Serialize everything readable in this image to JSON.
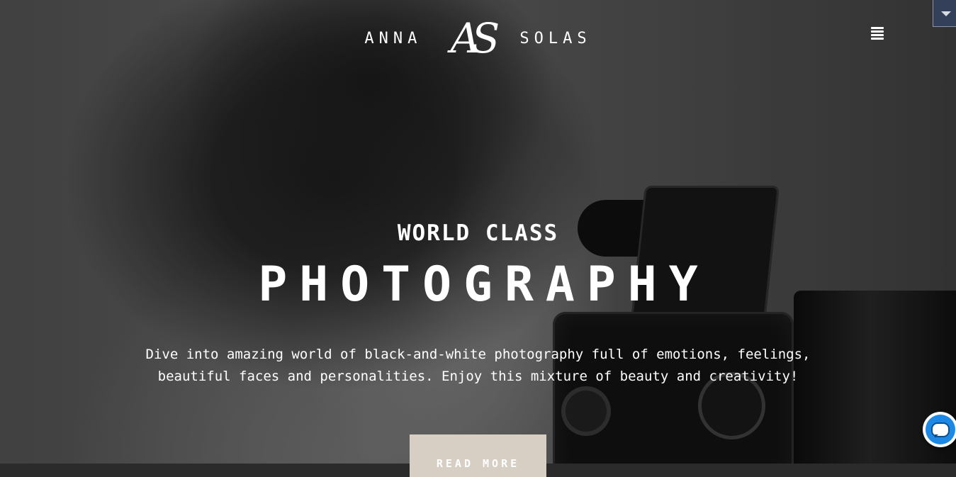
{
  "header": {
    "logo_first": "ANNA",
    "logo_monogram": "AS",
    "logo_last": "SOLAS"
  },
  "hero": {
    "tagline": "WORLD CLASS",
    "headline": "PHOTOGRAPHY",
    "description": "Dive into amazing world of black-and-white photography full of emotions, feelings, beautiful faces and personalities. Enjoy this mixture of beauty and creativity!",
    "cta_label": "READ MORE"
  },
  "icons": {
    "menu": "hamburger-menu-icon",
    "dropdown": "chevron-down-icon",
    "chat": "chat-bubble-icon"
  },
  "colors": {
    "cta_background": "#d7cfc4",
    "text": "#ffffff",
    "dropdown_background": "#34405a",
    "chat_accent": "#1e88e5"
  }
}
